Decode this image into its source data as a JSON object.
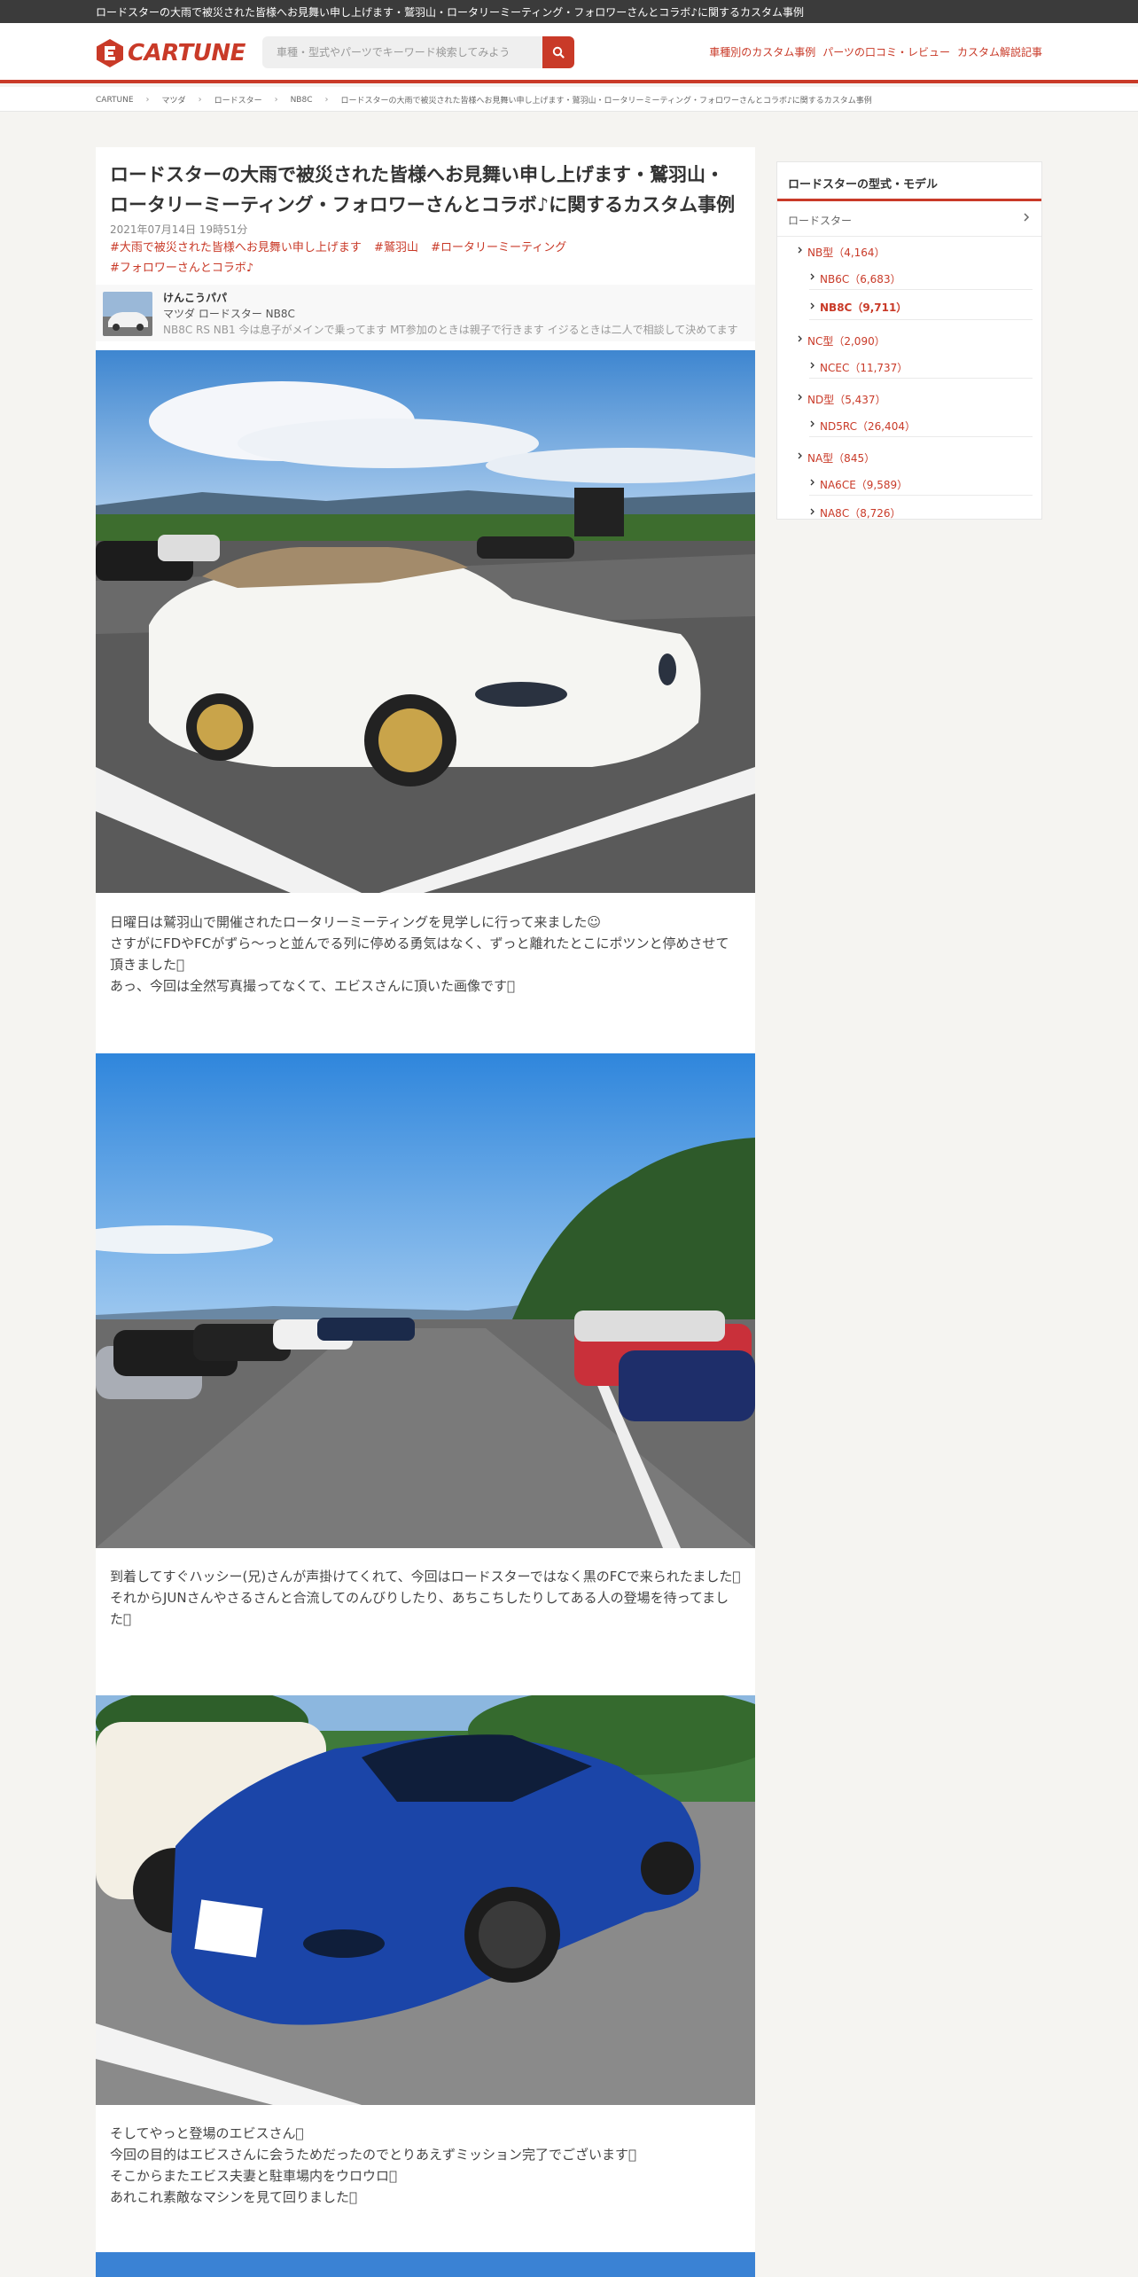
{
  "topbar": {
    "text": "ロードスターの大雨で被災された皆様へお見舞い申し上げます・鷲羽山・ロータリーミーティング・フォロワーさんとコラボ♪に関するカスタム事例"
  },
  "header": {
    "logo_text": "CARTUNE",
    "search_placeholder": "車種・型式やパーツでキーワード検索してみよう",
    "nav": [
      "車種別のカスタム事例",
      "パーツの口コミ・レビュー",
      "カスタム解説記事"
    ]
  },
  "breadcrumb": [
    "CARTUNE",
    "マツダ",
    "ロードスター",
    "NB8C",
    "ロードスターの大雨で被災された皆様へお見舞い申し上げます・鷲羽山・ロータリーミーティング・フォロワーさんとコラボ♪に関するカスタム事例"
  ],
  "article": {
    "title": "ロードスターの大雨で被災された皆様へお見舞い申し上げます・鷲羽山・ロータリーミーティング・フォロワーさんとコラボ♪に関するカスタム事例",
    "date": "2021年07月14日 19時51分",
    "tags": [
      "#大雨で被災された皆様へお見舞い申し上げます",
      "#鷲羽山",
      "#ロータリーミーティング",
      "#フォロワーさんとコラボ♪"
    ],
    "author": {
      "name": "けんこうパパ",
      "car": "マツダ ロードスター NB8C",
      "desc": "NB8C RS NB1 今は息子がメインで乗ってます MT参加のときは親子で行きます イジるときは二人で相談して決めてます"
    },
    "paragraphs": [
      [
        "日曜日は鷲羽山で開催されたロータリーミーティングを見学しに行って来ました☺",
        "さすがにFDやFCがずら～っと並んでる列に停める勇気はなく、ずっと離れたとこにポツンと停めさせて頂きました􀀀",
        "あっ、今回は全然写真撮ってなくて、エビスさんに頂いた画像です􀀀"
      ],
      [
        "到着してすぐハッシー(兄)さんが声掛けてくれて、今回はロードスターではなく黒のFCで来られたました􀀀",
        "それからJUNさんやさるさんと合流してのんびりしたり、あちこちしたりしてある人の登場を待ってました􀀀"
      ],
      [
        "そしてやっと登場のエビスさん􀀀",
        "今回の目的はエビスさんに会うためだったのでとりあえずミッション完了でございます􀀀",
        "そこからまたエビス夫妻と駐車場内をウロウロ􀀀",
        "あれこれ素敵なマシンを見て回りました􀀀"
      ]
    ]
  },
  "sidebar": {
    "title": "ロードスターの型式・モデル",
    "parent": "ロードスター",
    "items": [
      {
        "label": "NB型（4,164）",
        "level": 1
      },
      {
        "label": "NB6C（6,683）",
        "level": 2
      },
      {
        "label": "NB8C（9,711）",
        "level": 2,
        "active": true
      },
      {
        "label": "NC型（2,090）",
        "level": 1
      },
      {
        "label": "NCEC（11,737）",
        "level": 2
      },
      {
        "label": "ND型（5,437）",
        "level": 1
      },
      {
        "label": "ND5RC（26,404）",
        "level": 2
      },
      {
        "label": "NA型（845）",
        "level": 1
      },
      {
        "label": "NA6CE（9,589）",
        "level": 2
      },
      {
        "label": "NA8C（8,726）",
        "level": 2
      }
    ]
  },
  "colors": {
    "accent": "#c93a28",
    "topbar": "#3b3b3b",
    "page_bg": "#f5f4f1"
  }
}
